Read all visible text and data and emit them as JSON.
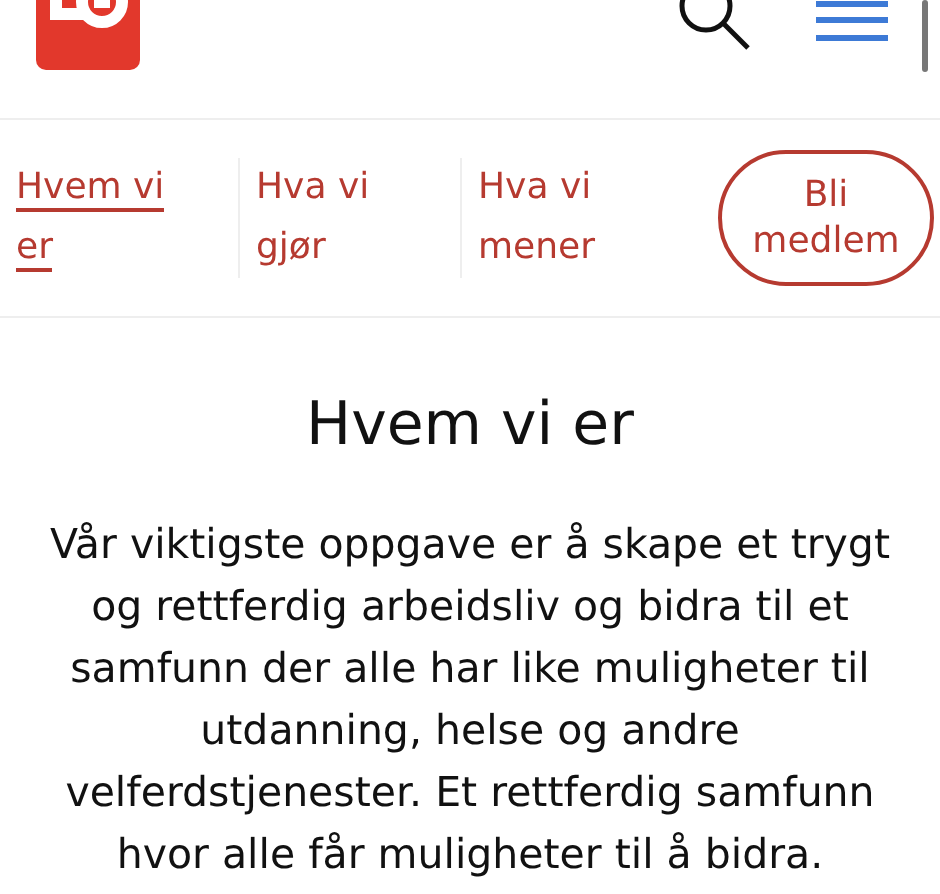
{
  "nav": {
    "tabs": [
      {
        "label": "Hvem vi er",
        "selected": true
      },
      {
        "label": "Hva vi gjør",
        "selected": false
      },
      {
        "label": "Hva vi mener",
        "selected": false
      }
    ],
    "join_button": "Bli medlem"
  },
  "content": {
    "heading": "Hvem vi er",
    "text": "Vår viktigste oppgave er å skape et trygt og rettferdig arbeidsliv og bidra til et samfunn der alle har like muligheter til utdanning, helse og andre velferdstjenester. Et rettferdig samfunn hvor alle får muligheter til å bidra."
  }
}
